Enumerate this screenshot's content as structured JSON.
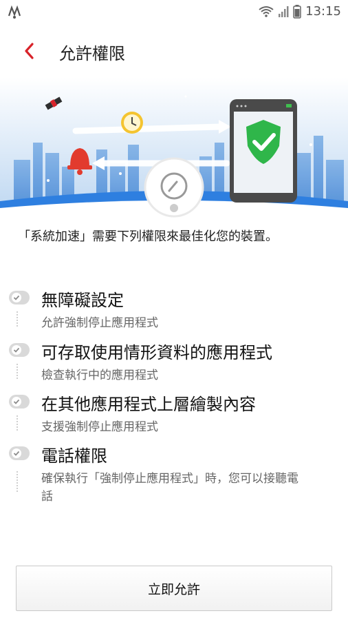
{
  "status_bar": {
    "time": "13:15",
    "icons": [
      "app-notification-icon",
      "wifi-icon",
      "signal-icon",
      "battery-icon"
    ]
  },
  "header": {
    "title": "允許權限",
    "back_icon": "chevron-left-icon",
    "accent_color": "#d8232a"
  },
  "intro": "「系統加速」需要下列權限來最佳化您的裝置。",
  "permissions": [
    {
      "title": "無障礙設定",
      "description": "允許強制停止應用程式"
    },
    {
      "title": "可存取使用情形資料的應用程式",
      "description": "檢查執行中的應用程式"
    },
    {
      "title": "在其他應用程式上層繪製內容",
      "description": "支援強制停止應用程式"
    },
    {
      "title": "電話權限",
      "description": "確保執行「強制停止應用程式」時，您可以接聽電話"
    }
  ],
  "allow_button": {
    "label": "立即允許"
  }
}
